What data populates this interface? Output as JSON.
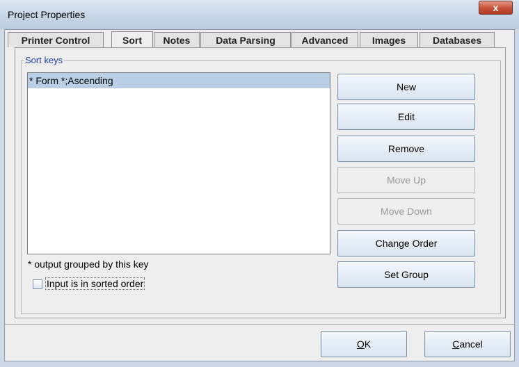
{
  "window": {
    "title": "Project Properties",
    "close_glyph": "x"
  },
  "tabs": [
    {
      "label": "Printer Control",
      "active": false
    },
    {
      "label": "Sort",
      "active": true
    },
    {
      "label": "Notes",
      "active": false
    },
    {
      "label": "Data Parsing",
      "active": false
    },
    {
      "label": "Advanced",
      "active": false
    },
    {
      "label": "Images",
      "active": false
    },
    {
      "label": "Databases",
      "active": false
    }
  ],
  "sort_keys": {
    "group_label": "Sort keys",
    "items": [
      "* Form *;Ascending"
    ],
    "selected_index": 0,
    "note": "* output grouped by this key",
    "checkbox_label": "Input is in sorted order",
    "checkbox_checked": false
  },
  "buttons": {
    "new": "New",
    "edit": "Edit",
    "remove": "Remove",
    "move_up": "Move Up",
    "move_down": "Move Down",
    "change_order": "Change Order",
    "set_group": "Set Group"
  },
  "footer": {
    "ok": "OK",
    "ok_mnemonic": "O",
    "ok_rest": "K",
    "cancel": "Cancel",
    "cancel_mnemonic": "C",
    "cancel_rest": "ancel"
  }
}
